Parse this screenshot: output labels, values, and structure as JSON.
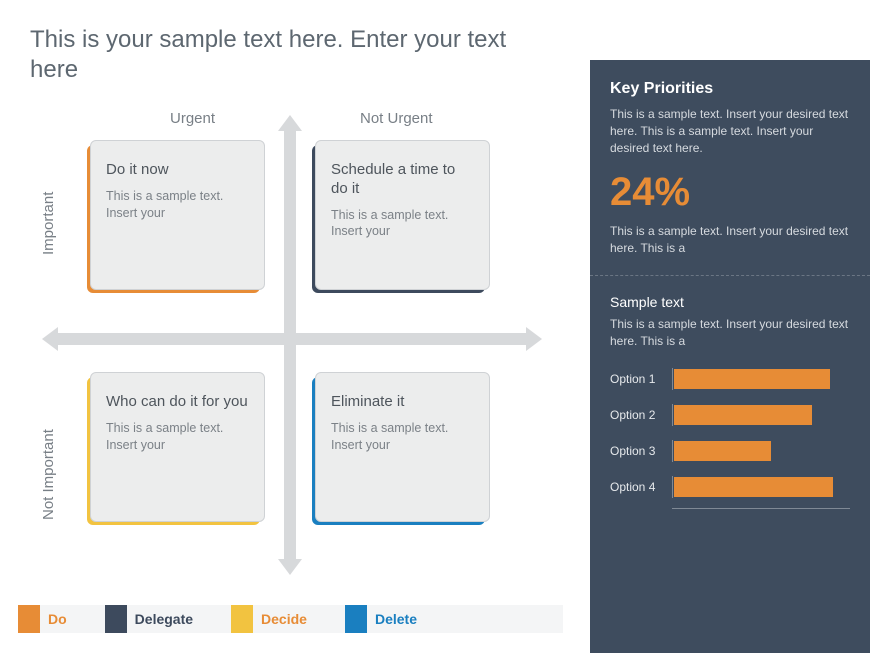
{
  "title": "This is your sample text here. Enter your text here",
  "matrix": {
    "axis_top_left": "Urgent",
    "axis_top_right": "Not Urgent",
    "axis_left_top": "Important",
    "axis_left_bottom": "Not Important",
    "quads": [
      {
        "title": "Do it now",
        "desc": "This is a sample text. Insert your"
      },
      {
        "title": "Schedule a time to do it",
        "desc": "This is a sample text. Insert your"
      },
      {
        "title": "Who can do it for you",
        "desc": "This is a sample text. Insert your"
      },
      {
        "title": "Eliminate it",
        "desc": "This is a sample text. Insert your"
      }
    ]
  },
  "legend": {
    "do": "Do",
    "delegate": "Delegate",
    "decide": "Decide",
    "delete": "Delete"
  },
  "sidebar": {
    "top": {
      "heading": "Key Priorities",
      "desc": "This is a sample text.  Insert your desired text here. This is a sample text.  Insert your desired text here.",
      "percent": "24%",
      "below_percent": "This is a sample text.  Insert your desired text here. This is a"
    },
    "bottom": {
      "heading": "Sample text",
      "desc": "This is a sample text.  Insert your desired text here. This is a"
    }
  },
  "chart_data": {
    "type": "bar",
    "orientation": "horizontal",
    "title": "",
    "xlabel": "",
    "ylabel": "",
    "xlim": [
      0,
      100
    ],
    "categories": [
      "Option 1",
      "Option 2",
      "Option 3",
      "Option 4"
    ],
    "values": [
      88,
      78,
      55,
      90
    ],
    "bar_color": "#e78c36"
  }
}
